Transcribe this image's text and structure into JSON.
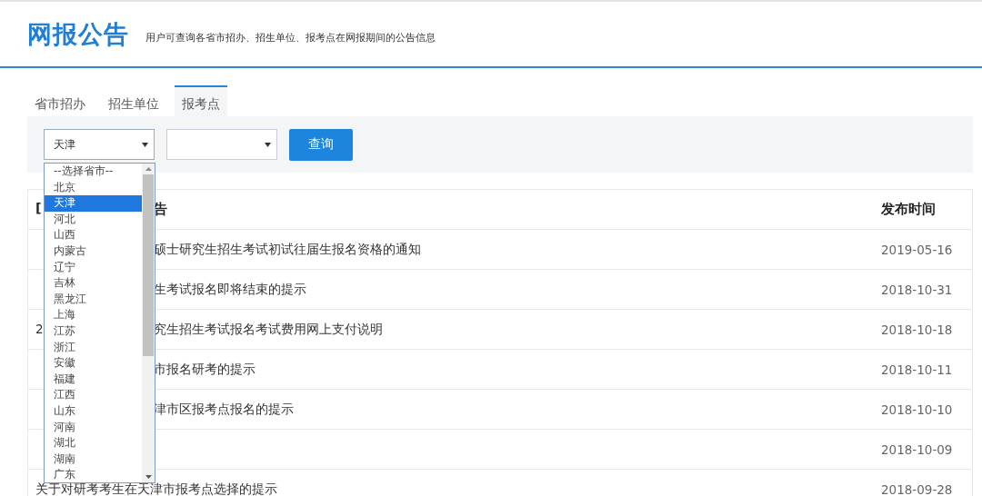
{
  "header": {
    "title": "网报公告",
    "subtitle": "用户可查询各省市招办、招生单位、报考点在网报期间的公告信息"
  },
  "tabs": [
    {
      "label": "省市招办",
      "selected": false
    },
    {
      "label": "招生单位",
      "selected": false
    },
    {
      "label": "报考点",
      "selected": true
    }
  ],
  "filters": {
    "province_select": {
      "value": "天津",
      "expanded": true
    },
    "site_select": {
      "expanded": false
    },
    "search_button": "查询"
  },
  "province_options": [
    {
      "label": "--选择省市--",
      "selected": false
    },
    {
      "label": "北京",
      "selected": false
    },
    {
      "label": "天津",
      "selected": true
    },
    {
      "label": "河北",
      "selected": false
    },
    {
      "label": "山西",
      "selected": false
    },
    {
      "label": "内蒙古",
      "selected": false
    },
    {
      "label": "辽宁",
      "selected": false
    },
    {
      "label": "吉林",
      "selected": false
    },
    {
      "label": "黑龙江",
      "selected": false
    },
    {
      "label": "上海",
      "selected": false
    },
    {
      "label": "江苏",
      "selected": false
    },
    {
      "label": "浙江",
      "selected": false
    },
    {
      "label": "安徽",
      "selected": false
    },
    {
      "label": "福建",
      "selected": false
    },
    {
      "label": "江西",
      "selected": false
    },
    {
      "label": "山东",
      "selected": false
    },
    {
      "label": "河南",
      "selected": false
    },
    {
      "label": "湖北",
      "selected": false
    },
    {
      "label": "湖南",
      "selected": false
    },
    {
      "label": "广东",
      "selected": false
    }
  ],
  "table": {
    "header": {
      "lead": "[",
      "title": "告",
      "date": "发布时间",
      "covered": true
    },
    "rows": [
      {
        "title": "硕士研究生招生考试初试往届生报名资格的通知",
        "date": "2019-05-16",
        "covered": true
      },
      {
        "title": "生考试报名即将结束的提示",
        "date": "2018-10-31",
        "covered": true
      },
      {
        "lead": "2",
        "title": "究生招生考试报名考试费用网上支付说明",
        "date": "2018-10-18",
        "covered": true
      },
      {
        "title": "市报名研考的提示",
        "date": "2018-10-11",
        "covered": true
      },
      {
        "title": "津市区报考点报名的提示",
        "date": "2018-10-10",
        "covered": true
      },
      {
        "date": "2018-10-09",
        "covered": true
      },
      {
        "title": "关于对研考考生在天津市报考点选择的提示",
        "date": "2018-09-28",
        "covered": false
      }
    ]
  }
}
